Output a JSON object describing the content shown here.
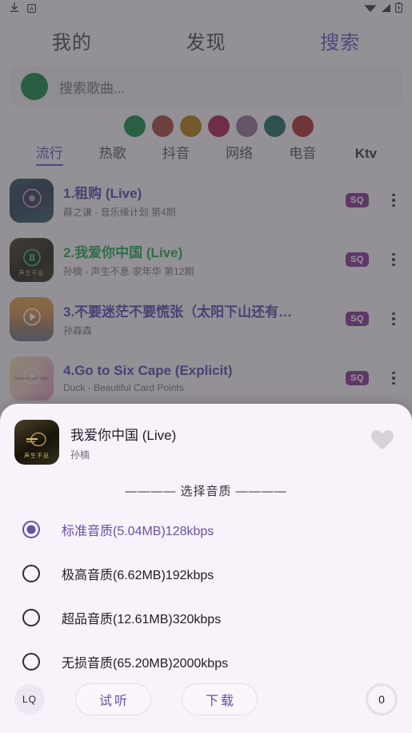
{
  "status_bar": {
    "left_icons": [
      "download-icon",
      "a-badge-icon"
    ],
    "right_icons": [
      "wifi-icon",
      "signal-icon",
      "battery-charging-icon"
    ]
  },
  "top_tabs": [
    {
      "label": "我的",
      "active": false
    },
    {
      "label": "发现",
      "active": false
    },
    {
      "label": "搜索",
      "active": true
    }
  ],
  "search": {
    "placeholder": "搜索歌曲...",
    "avatar_color": "#05803b"
  },
  "category_circles": [
    {
      "color": "#0b8240"
    },
    {
      "color": "#9d3b33"
    },
    {
      "color": "#a87508"
    },
    {
      "color": "#a5104a"
    },
    {
      "color": "#8b6a94"
    },
    {
      "color": "#13605c"
    },
    {
      "color": "#a62423"
    }
  ],
  "category_tabs": [
    {
      "label": "流行",
      "active": true,
      "bold": false
    },
    {
      "label": "热歌",
      "active": false,
      "bold": false
    },
    {
      "label": "抖音",
      "active": false,
      "bold": false
    },
    {
      "label": "网络",
      "active": false,
      "bold": false
    },
    {
      "label": "电音",
      "active": false,
      "bold": false
    },
    {
      "label": "Ktv",
      "active": false,
      "bold": true
    }
  ],
  "songs": [
    {
      "title": "1.租购 (Live)",
      "subtitle": "薛之谦 - 音乐缘计划 第4期",
      "badge": "SQ",
      "playing": false
    },
    {
      "title": "2.我爱你中国 (Live)",
      "subtitle": "孙楠 - 声生不息·家年华 第12期",
      "badge": "SQ",
      "playing": true,
      "art_label": "声生不息"
    },
    {
      "title": "3.不要迷茫不要慌张（太阳下山还有…",
      "subtitle": "孙森森",
      "badge": "SQ",
      "playing": false
    },
    {
      "title": "4.Go to Six Cape (Explicit)",
      "subtitle": "Duck - Beautiful Card Points",
      "badge": "SQ",
      "playing": false,
      "art_tiny": "Beautiful Card Points"
    }
  ],
  "sheet": {
    "title": "我爱你中国 (Live)",
    "artist": "孙楠",
    "art_label": "声生不息",
    "favorite_icon": "heart-icon",
    "quality_header": "———— 选择音质 ————",
    "options": [
      {
        "label": "标准音质(5.04MB)128kbps",
        "selected": true
      },
      {
        "label": "极高音质(6.62MB)192kbps",
        "selected": false
      },
      {
        "label": "超品音质(12.61MB)320kbps",
        "selected": false
      },
      {
        "label": "无损音质(65.20MB)2000kbps",
        "selected": false
      }
    ],
    "actions": {
      "quality_chip": "LQ",
      "preview_label": "试听",
      "download_label": "下载",
      "counter": "0"
    }
  },
  "colors": {
    "accent": "#6750a4",
    "accent_title": "#4a3fa8",
    "playing": "#18a34a",
    "badge": "#7b2a8e",
    "sheet_bg": "#f8f2fb"
  }
}
